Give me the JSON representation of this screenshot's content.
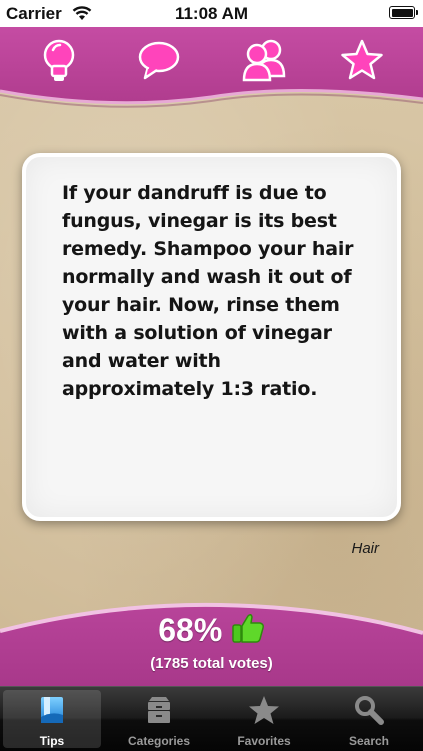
{
  "status_bar": {
    "carrier": "Carrier",
    "time": "11:08 AM"
  },
  "top_nav": {
    "icons": [
      "lightbulb-icon",
      "speech-bubble-icon",
      "people-icon",
      "star-icon"
    ],
    "icon_color": "#ff3fb8",
    "band_color": "#b8429a"
  },
  "tip": {
    "text": "If your dandruff is due to fungus, vinegar is its best remedy. Shampoo your hair normally and wash it out of your hair. Now, rinse them with a solution of vinegar and water with approximately 1:3 ratio.",
    "category": "Hair"
  },
  "votes": {
    "percent": "68%",
    "total": "(1785 total votes)",
    "thumb_color": "#4cc81e"
  },
  "tab_bar": {
    "selected": "Tips",
    "tabs": [
      {
        "label": "Tips",
        "icon": "tips-book-icon"
      },
      {
        "label": "Categories",
        "icon": "categories-box-icon"
      },
      {
        "label": "Favorites",
        "icon": "star-icon"
      },
      {
        "label": "Search",
        "icon": "magnifier-icon"
      }
    ]
  }
}
